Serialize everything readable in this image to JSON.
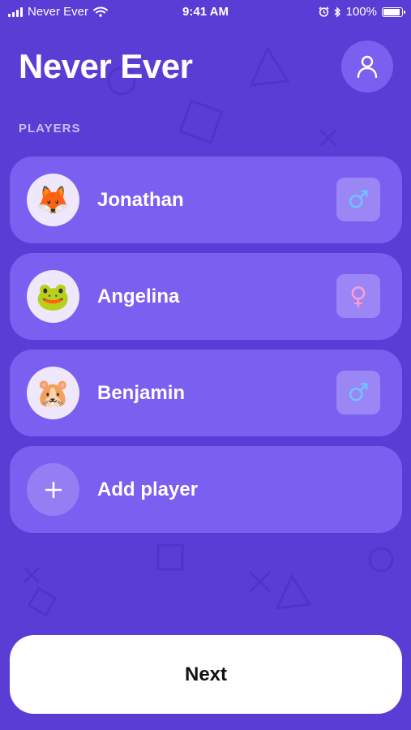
{
  "status_bar": {
    "carrier": "Never Ever",
    "time": "9:41 AM",
    "battery": "100%"
  },
  "header": {
    "title": "Never Ever",
    "profile_icon": "person-icon"
  },
  "players_section": {
    "label": "PLAYERS",
    "players": [
      {
        "name": "Jonathan",
        "avatar": "🦊",
        "gender": "male",
        "gender_symbol": "♂",
        "gender_color": "#6fc3ff"
      },
      {
        "name": "Angelina",
        "avatar": "🐸",
        "gender": "female",
        "gender_symbol": "♀",
        "gender_color": "#ff9ad5"
      },
      {
        "name": "Benjamin",
        "avatar": "🐹",
        "gender": "male",
        "gender_symbol": "♂",
        "gender_color": "#6fc3ff"
      }
    ],
    "add_player_label": "Add player"
  },
  "footer": {
    "next_label": "Next"
  },
  "colors": {
    "background": "#5a3dd4",
    "card": "#7a5ff0",
    "gender_badge": "#9a86f4"
  }
}
